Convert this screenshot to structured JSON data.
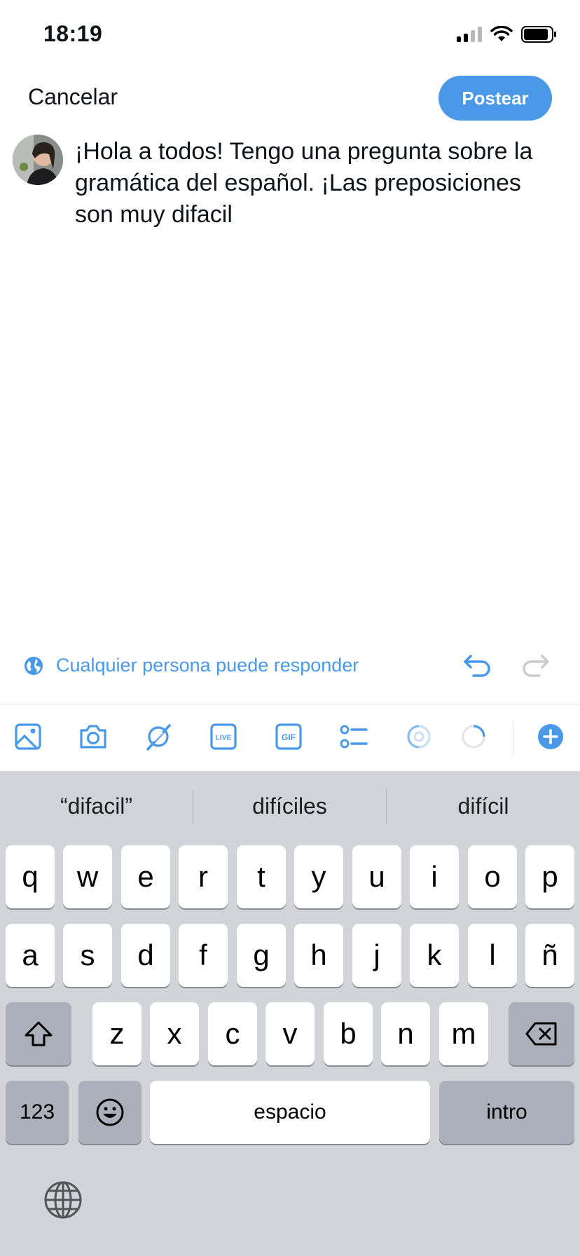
{
  "status": {
    "time": "18:19"
  },
  "header": {
    "cancel_label": "Cancelar",
    "post_label": "Postear"
  },
  "composer": {
    "text": "¡Hola a todos! Tengo una pregunta sobre la gramática del español. ¡Las preposiciones son muy difacil"
  },
  "reply": {
    "label": "Cualquier persona puede responder"
  },
  "toolbar": {
    "icons": [
      "image-icon",
      "camera-icon",
      "grok-icon",
      "live-icon",
      "gif-icon",
      "poll-icon",
      "location-icon",
      "character-counter-icon",
      "add-thread-icon"
    ],
    "accent_color": "#4a99e9"
  },
  "keyboard": {
    "suggestions": [
      "“difacil”",
      "difíciles",
      "difícil"
    ],
    "row1": [
      "q",
      "w",
      "e",
      "r",
      "t",
      "y",
      "u",
      "i",
      "o",
      "p"
    ],
    "row2": [
      "a",
      "s",
      "d",
      "f",
      "g",
      "h",
      "j",
      "k",
      "l",
      "ñ"
    ],
    "row3": [
      "z",
      "x",
      "c",
      "v",
      "b",
      "n",
      "m"
    ],
    "numbers_label": "123",
    "space_label": "espacio",
    "return_label": "intro"
  }
}
